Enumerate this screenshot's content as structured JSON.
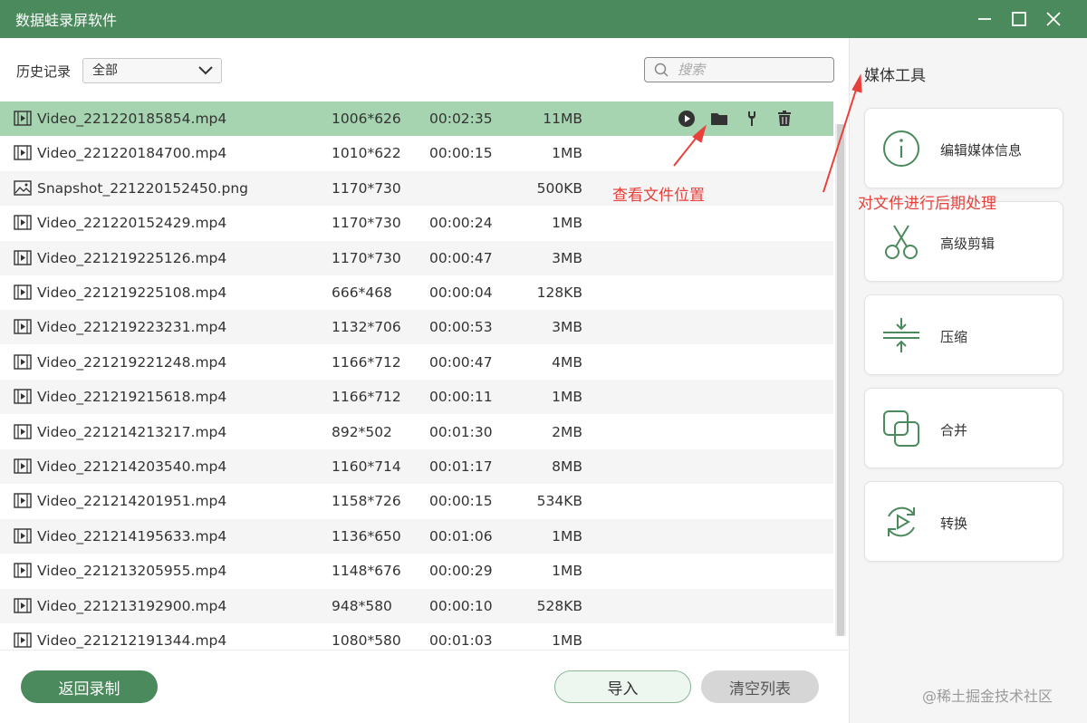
{
  "window": {
    "title": "数据蛙录屏软件"
  },
  "history": {
    "label": "历史记录",
    "filter_value": "全部"
  },
  "search": {
    "placeholder": "搜索"
  },
  "files": [
    {
      "name": "Video_221220185854.mp4",
      "resolution": "1006*626",
      "duration": "00:02:35",
      "size": "11MB",
      "type": "video"
    },
    {
      "name": "Video_221220184700.mp4",
      "resolution": "1010*622",
      "duration": "00:00:15",
      "size": "1MB",
      "type": "video"
    },
    {
      "name": "Snapshot_221220152450.png",
      "resolution": "1170*730",
      "duration": "",
      "size": "500KB",
      "type": "image"
    },
    {
      "name": "Video_221220152429.mp4",
      "resolution": "1170*730",
      "duration": "00:00:24",
      "size": "1MB",
      "type": "video"
    },
    {
      "name": "Video_221219225126.mp4",
      "resolution": "1170*730",
      "duration": "00:00:47",
      "size": "3MB",
      "type": "video"
    },
    {
      "name": "Video_221219225108.mp4",
      "resolution": "666*468",
      "duration": "00:00:04",
      "size": "128KB",
      "type": "video"
    },
    {
      "name": "Video_221219223231.mp4",
      "resolution": "1132*706",
      "duration": "00:00:53",
      "size": "3MB",
      "type": "video"
    },
    {
      "name": "Video_221219221248.mp4",
      "resolution": "1166*712",
      "duration": "00:00:47",
      "size": "4MB",
      "type": "video"
    },
    {
      "name": "Video_221219215618.mp4",
      "resolution": "1166*712",
      "duration": "00:00:11",
      "size": "1MB",
      "type": "video"
    },
    {
      "name": "Video_221214213217.mp4",
      "resolution": "892*502",
      "duration": "00:01:30",
      "size": "2MB",
      "type": "video"
    },
    {
      "name": "Video_221214203540.mp4",
      "resolution": "1160*714",
      "duration": "00:01:17",
      "size": "8MB",
      "type": "video"
    },
    {
      "name": "Video_221214201951.mp4",
      "resolution": "1158*726",
      "duration": "00:00:15",
      "size": "534KB",
      "type": "video"
    },
    {
      "name": "Video_221214195633.mp4",
      "resolution": "1136*650",
      "duration": "00:01:06",
      "size": "1MB",
      "type": "video"
    },
    {
      "name": "Video_221213205955.mp4",
      "resolution": "1148*676",
      "duration": "00:00:29",
      "size": "1MB",
      "type": "video"
    },
    {
      "name": "Video_221213192900.mp4",
      "resolution": "948*580",
      "duration": "00:00:10",
      "size": "528KB",
      "type": "video"
    },
    {
      "name": "Video_221212191344.mp4",
      "resolution": "1080*580",
      "duration": "00:01:03",
      "size": "1MB",
      "type": "video"
    }
  ],
  "row_actions": [
    "play-icon",
    "folder-icon",
    "wrench-icon",
    "trash-icon"
  ],
  "buttons": {
    "back": "返回录制",
    "import": "导入",
    "clear": "清空列表"
  },
  "media_tools": {
    "title": "媒体工具",
    "items": [
      {
        "label": "编辑媒体信息",
        "icon": "info-icon"
      },
      {
        "label": "高级剪辑",
        "icon": "scissors-icon"
      },
      {
        "label": "压缩",
        "icon": "compress-icon"
      },
      {
        "label": "合并",
        "icon": "merge-icon"
      },
      {
        "label": "转换",
        "icon": "convert-icon"
      }
    ]
  },
  "annotations": {
    "folder_note": "查看文件位置",
    "tools_note": "对文件进行后期处理"
  },
  "watermark": "@稀土掘金技术社区",
  "colors": {
    "brand": "#4a8a5c",
    "selected_row": "#a6d3b0",
    "annotation": "#e8403a"
  }
}
